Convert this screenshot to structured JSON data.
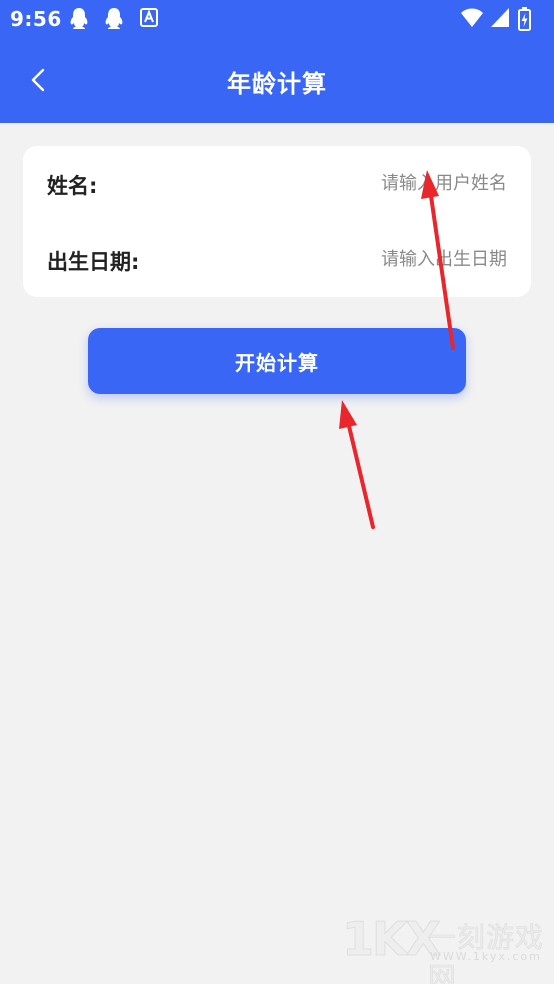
{
  "status_bar": {
    "time": "9:56",
    "left_icons": [
      "qq-icon",
      "qq-icon",
      "text-input-app-icon"
    ],
    "right_icons": [
      "wifi-icon",
      "signal-icon",
      "battery-charging-icon"
    ]
  },
  "nav": {
    "back_icon": "chevron-left-icon",
    "title": "年龄计算"
  },
  "form": {
    "name": {
      "label": "姓名:",
      "placeholder": "请输入用户姓名",
      "value": ""
    },
    "birth_date": {
      "label": "出生日期:",
      "placeholder": "请输入出生日期",
      "value": ""
    }
  },
  "actions": {
    "start_label": "开始计算"
  },
  "watermark": {
    "logo": "1KX",
    "name": "一刻游戏网",
    "url": "WWW.1kyx.com"
  },
  "colors": {
    "primary": "#3a66f5",
    "background": "#f2f2f2",
    "card": "#ffffff",
    "annotation_arrow": "#e8262c"
  }
}
